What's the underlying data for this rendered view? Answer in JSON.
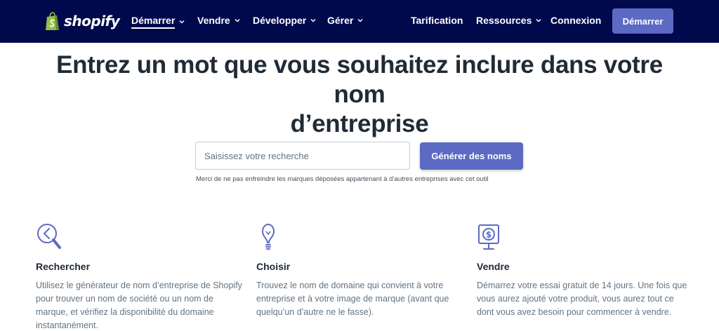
{
  "brand": {
    "logo_text": "shopify",
    "accent": "#5c6ac4",
    "nav_bg": "#00094c"
  },
  "nav": {
    "left_items": [
      {
        "label": "Démarrer",
        "has_dropdown": true,
        "active": true
      },
      {
        "label": "Vendre",
        "has_dropdown": true
      },
      {
        "label": "Développer",
        "has_dropdown": true
      },
      {
        "label": "Gérer",
        "has_dropdown": true
      }
    ],
    "right_items": [
      {
        "label": "Tarification",
        "has_dropdown": false
      },
      {
        "label": "Ressources",
        "has_dropdown": true
      },
      {
        "label": "Connexion",
        "has_dropdown": false
      }
    ],
    "cta_label": "Démarrer"
  },
  "hero": {
    "title_line1": "Entrez un mot que vous souhaitez inclure dans votre nom",
    "title_line2": "d’entreprise"
  },
  "search": {
    "placeholder": "Saisissez votre recherche",
    "value": "",
    "button_label": "Générer des noms",
    "disclaimer": "Merci de ne pas enfreindre les marques déposées appartenant à d’autres entreprises avec cet outil"
  },
  "features": [
    {
      "icon": "magnifier-icon",
      "title": "Rechercher",
      "text": "Utilisez le générateur de nom d’entreprise de Shopify pour trouver un nom de société ou un nom de marque, et vérifiez la disponibilité du domaine instantanément."
    },
    {
      "icon": "lightbulb-icon",
      "title": "Choisir",
      "text": "Trouvez le nom de domaine qui convient à votre entreprise et à votre image de marque (avant que quelqu’un d’autre ne le fasse)."
    },
    {
      "icon": "dollar-sign-icon",
      "title": "Vendre",
      "text": "Démarrez votre essai gratuit de 14 jours. Une fois que vous aurez ajouté votre produit, vous aurez tout ce dont vous avez besoin pour commencer à vendre."
    }
  ]
}
